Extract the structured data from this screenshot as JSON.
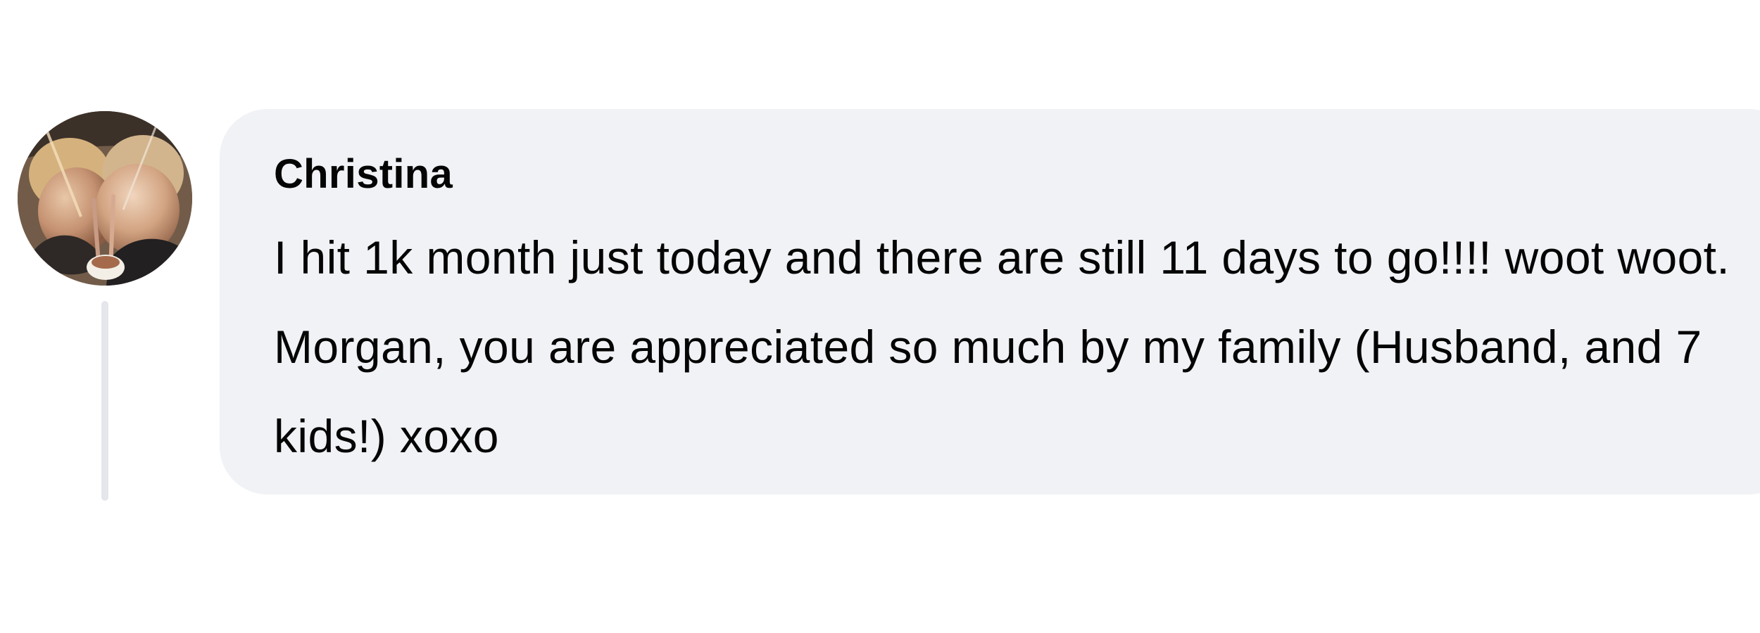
{
  "comment": {
    "author": "Christina",
    "text": "I hit 1k month just today and there are still 11 days to go!!!! woot woot. Morgan, you are appreciated so much by my family (Husband, and 7 kids!) xoxo"
  },
  "colors": {
    "bubble_background": "#f0f2f5",
    "text": "#050505",
    "thread_line": "#e4e6eb"
  },
  "icons": {
    "avatar": "profile-photo-avatar"
  }
}
